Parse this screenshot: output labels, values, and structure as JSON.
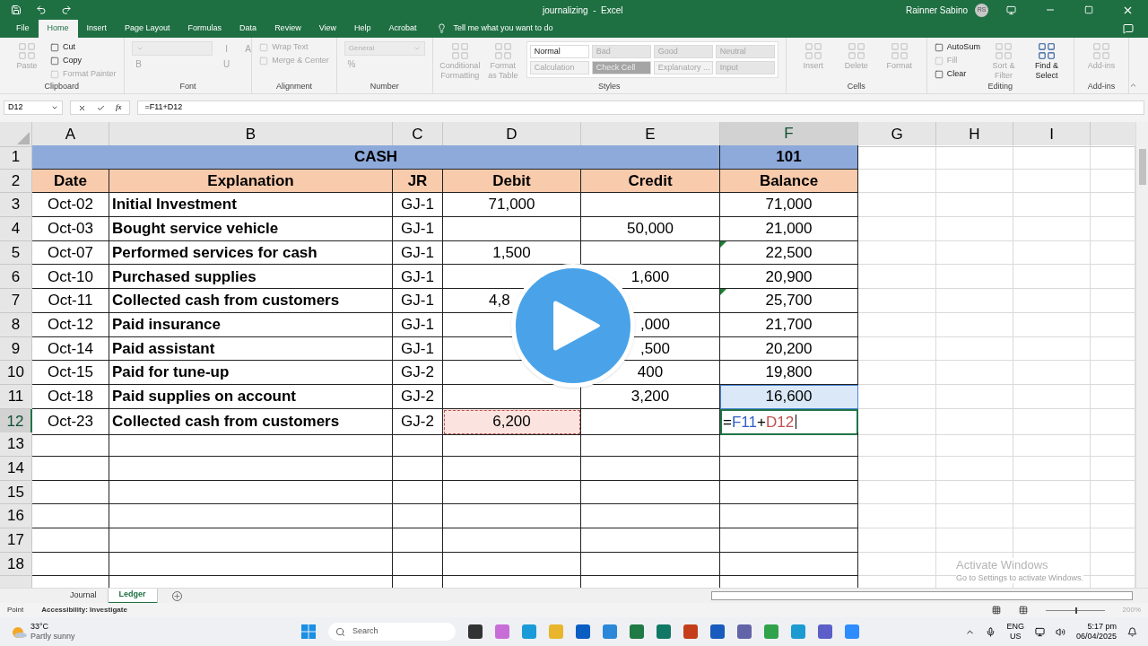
{
  "window": {
    "title": "journalizing  -  Excel",
    "user": "Rainner Sabino",
    "avatar": "RS"
  },
  "tabs": [
    {
      "label": "File",
      "selected": false
    },
    {
      "label": "Home",
      "selected": true
    },
    {
      "label": "Insert",
      "selected": false
    },
    {
      "label": "Page Layout",
      "selected": false
    },
    {
      "label": "Formulas",
      "selected": false
    },
    {
      "label": "Data",
      "selected": false
    },
    {
      "label": "Review",
      "selected": false
    },
    {
      "label": "View",
      "selected": false
    },
    {
      "label": "Help",
      "selected": false
    },
    {
      "label": "Acrobat",
      "selected": false
    }
  ],
  "tell_me": "Tell me what you want to do",
  "ribbon": [
    {
      "label": "Clipboard",
      "items": [
        {
          "kind": "large",
          "text": "Paste",
          "disabled": true
        },
        {
          "kind": "small",
          "text": "Cut",
          "disabled": false
        },
        {
          "kind": "small",
          "text": "Copy",
          "disabled": false
        },
        {
          "kind": "small",
          "text": "Format Painter",
          "disabled": true
        }
      ]
    },
    {
      "label": "Font",
      "items": [
        {
          "kind": "field",
          "disabled": true
        },
        {
          "kind": "glyph",
          "text": "B",
          "disabled": true
        },
        {
          "kind": "glyph",
          "text": "I",
          "disabled": true
        },
        {
          "kind": "glyph",
          "text": "U",
          "disabled": true
        },
        {
          "kind": "glyph",
          "text": "A",
          "disabled": true
        }
      ]
    },
    {
      "label": "Alignment",
      "items": [
        {
          "kind": "small",
          "text": "Wrap Text",
          "disabled": true
        },
        {
          "kind": "small",
          "text": "Merge & Center",
          "disabled": true
        }
      ]
    },
    {
      "label": "Number",
      "items": [
        {
          "kind": "field",
          "text": "General",
          "disabled": true
        },
        {
          "kind": "glyph",
          "text": "%",
          "disabled": true
        }
      ]
    },
    {
      "label": "Styles",
      "items": [
        {
          "kind": "large",
          "text": "Conditional Formatting",
          "disabled": true
        },
        {
          "kind": "large",
          "text": "Format as Table",
          "disabled": true
        },
        {
          "kind": "style",
          "text": "Normal",
          "disabled": false,
          "color": "#ffffff"
        },
        {
          "kind": "style",
          "text": "Calculation",
          "disabled": true,
          "color": "#f2f2f2"
        },
        {
          "kind": "style",
          "text": "Bad",
          "disabled": true,
          "color": "#e6e6e6"
        },
        {
          "kind": "style",
          "text": "Check Cell",
          "disabled": true,
          "color": "#a5a5a5"
        },
        {
          "kind": "style",
          "text": "Good",
          "disabled": true,
          "color": "#e6e6e6"
        },
        {
          "kind": "style",
          "text": "Explanatory ...",
          "disabled": true,
          "color": "#f2f2f2"
        },
        {
          "kind": "style",
          "text": "Neutral",
          "disabled": true,
          "color": "#e6e6e6"
        },
        {
          "kind": "style",
          "text": "Input",
          "disabled": true,
          "color": "#e6e6e6"
        }
      ]
    },
    {
      "label": "Cells",
      "items": [
        {
          "kind": "large",
          "text": "Insert",
          "disabled": true
        },
        {
          "kind": "large",
          "text": "Delete",
          "disabled": true
        },
        {
          "kind": "large",
          "text": "Format",
          "disabled": true
        }
      ]
    },
    {
      "label": "Editing",
      "items": [
        {
          "kind": "small",
          "text": "AutoSum",
          "disabled": false
        },
        {
          "kind": "small",
          "text": "Fill",
          "disabled": true
        },
        {
          "kind": "small",
          "text": "Clear",
          "disabled": false
        },
        {
          "kind": "large",
          "text": "Sort & Filter",
          "disabled": true
        },
        {
          "kind": "large",
          "text": "Find & Select",
          "disabled": false
        }
      ]
    },
    {
      "label": "Add-ins",
      "items": [
        {
          "kind": "large",
          "text": "Add-ins",
          "disabled": true
        }
      ]
    }
  ],
  "name_box": "D12",
  "function_label": "fx",
  "formula": "=F11+D12",
  "columns": [
    {
      "label": "A",
      "selected": false
    },
    {
      "label": "B",
      "selected": false
    },
    {
      "label": "C",
      "selected": false
    },
    {
      "label": "D",
      "selected": false
    },
    {
      "label": "E",
      "selected": false
    },
    {
      "label": "F",
      "selected": true
    },
    {
      "label": "G",
      "selected": false
    },
    {
      "label": "H",
      "selected": false
    },
    {
      "label": "I",
      "selected": false
    }
  ],
  "row_numbers": [
    {
      "label": "1",
      "selected": false
    },
    {
      "label": "2",
      "selected": false
    },
    {
      "label": "3",
      "selected": false
    },
    {
      "label": "4",
      "selected": false
    },
    {
      "label": "5",
      "selected": false
    },
    {
      "label": "6",
      "selected": false
    },
    {
      "label": "7",
      "selected": false
    },
    {
      "label": "8",
      "selected": false
    },
    {
      "label": "9",
      "selected": false
    },
    {
      "label": "10",
      "selected": false
    },
    {
      "label": "11",
      "selected": false
    },
    {
      "label": "12",
      "selected": true
    },
    {
      "label": "13",
      "selected": false
    },
    {
      "label": "14",
      "selected": false
    },
    {
      "label": "15",
      "selected": false
    },
    {
      "label": "16",
      "selected": false
    },
    {
      "label": "17",
      "selected": false
    },
    {
      "label": "18",
      "selected": false
    }
  ],
  "ledger": {
    "title": "CASH",
    "account": "101",
    "headers": [
      "Date",
      "Explanation",
      "JR",
      "Debit",
      "Credit",
      "Balance"
    ],
    "rows": [
      {
        "date": "Oct-02",
        "explanation": "Initial Investment",
        "jr": "GJ-1",
        "debit": "71,000",
        "balance": "71,000"
      },
      {
        "date": "Oct-03",
        "explanation": "Bought service vehicle",
        "jr": "GJ-1",
        "credit": "50,000",
        "balance": "21,000"
      },
      {
        "date": "Oct-07",
        "explanation": "Performed services for cash",
        "jr": "GJ-1",
        "debit": "1,500",
        "balance": "22,500",
        "balance_flag": true
      },
      {
        "date": "Oct-10",
        "explanation": "Purchased supplies",
        "jr": "GJ-1",
        "credit": "1,600",
        "balance": "20,900"
      },
      {
        "date": "Oct-11",
        "explanation": "Collected cash from customers",
        "jr": "GJ-1",
        "debit": "4,8",
        "debit_clipped": true,
        "balance": "25,700",
        "balance_flag": true
      },
      {
        "date": "Oct-12",
        "explanation": "Paid insurance",
        "jr": "GJ-1",
        "credit": ",000",
        "credit_clipped": true,
        "balance": "21,700"
      },
      {
        "date": "Oct-14",
        "explanation": "Paid assistant",
        "jr": "GJ-1",
        "credit": ",500",
        "credit_clipped": true,
        "balance": "20,200"
      },
      {
        "date": "Oct-15",
        "explanation": "Paid for tune-up",
        "jr": "GJ-2",
        "credit": "400",
        "balance": "19,800"
      },
      {
        "date": "Oct-18",
        "explanation": "Paid supplies on account",
        "jr": "GJ-2",
        "credit": "3,200",
        "balance": "16,600",
        "balance_selected": true
      },
      {
        "date": "Oct-23",
        "explanation": "Collected cash from customers",
        "jr": "GJ-2",
        "debit": "6,200",
        "debit_referenced": true,
        "balance_formula": [
          {
            "text": "=",
            "color": "#000000"
          },
          {
            "text": "F11",
            "color": "#2f5fc7"
          },
          {
            "text": "+",
            "color": "#000000"
          },
          {
            "text": "D12",
            "color": "#c0504d"
          }
        ]
      }
    ]
  },
  "activation": {
    "title": "Activate Windows",
    "text": "Go to Settings to activate Windows."
  },
  "sheets": [
    {
      "label": "Journal",
      "selected": false
    },
    {
      "label": "Ledger",
      "selected": true
    }
  ],
  "status": {
    "mode": "Point",
    "accessibility": "Accessibility: Investigate",
    "zoom": "200%",
    "zoom_slider": {
      "level": 0.5
    }
  },
  "taskbar": {
    "temperature": "33°C",
    "weather": "Partly sunny",
    "search_placeholder": "Search",
    "language": "ENG",
    "region": "US",
    "time": "5:17 pm",
    "date": "06/04/2025"
  }
}
